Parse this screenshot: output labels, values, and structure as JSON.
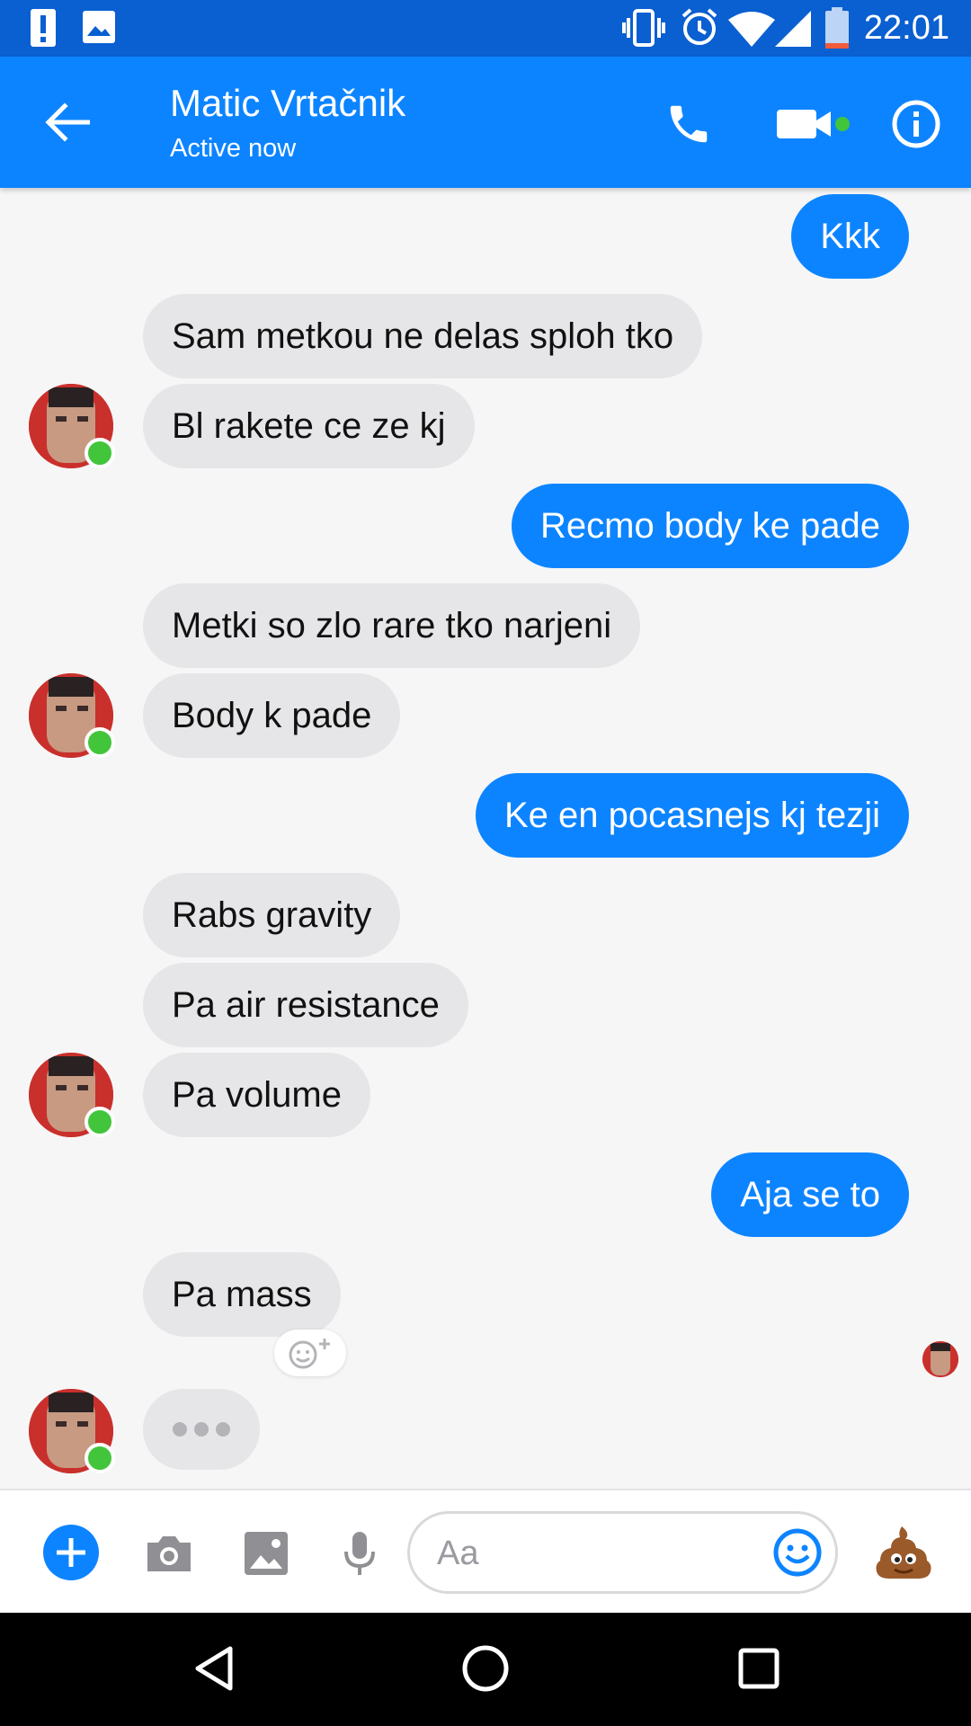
{
  "status_bar": {
    "time": "22:01",
    "icons": [
      "alert-icon",
      "image-icon",
      "vibrate-icon",
      "alarm-icon",
      "wifi-icon",
      "signal-icon",
      "battery-icon"
    ]
  },
  "header": {
    "contact_name": "Matic Vrtačnik",
    "status": "Active now",
    "icons": [
      "back-arrow-icon",
      "phone-icon",
      "video-camera-icon",
      "info-icon"
    ]
  },
  "messages": [
    {
      "from": "me",
      "text": "Kkk"
    },
    {
      "from": "them",
      "text": "Sam metkou ne delas sploh tko"
    },
    {
      "from": "them",
      "text": "Bl rakete ce ze kj"
    },
    {
      "from": "me",
      "text": "Recmo body ke pade"
    },
    {
      "from": "them",
      "text": "Metki so zlo rare tko narjeni"
    },
    {
      "from": "them",
      "text": "Body k pade"
    },
    {
      "from": "me",
      "text": "Ke en pocasnejs kj tezji"
    },
    {
      "from": "them",
      "text": "Rabs gravity"
    },
    {
      "from": "them",
      "text": "Pa air resistance"
    },
    {
      "from": "them",
      "text": "Pa volume"
    },
    {
      "from": "me",
      "text": "Aja se to"
    },
    {
      "from": "them",
      "text": "Pa mass"
    }
  ],
  "composer": {
    "placeholder": "Aa",
    "icons": [
      "plus-icon",
      "camera-icon",
      "gallery-icon",
      "microphone-icon",
      "emoji-icon",
      "poop-emoji-icon"
    ]
  },
  "colors": {
    "accent": "#0d84ff",
    "status_bar": "#0a5fd1",
    "incoming_bubble": "#e6e6e8",
    "online_dot": "#42c53b"
  }
}
